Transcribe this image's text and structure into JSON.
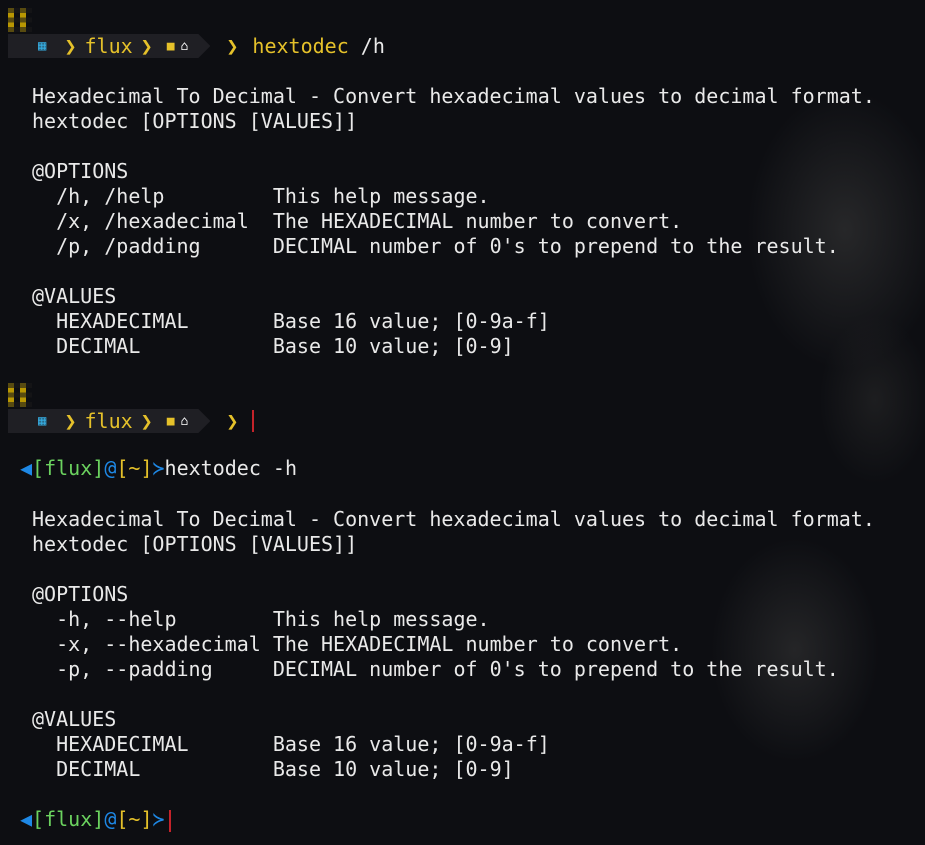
{
  "prompt1": {
    "user": "flux",
    "command_name": "hextodec",
    "command_arg": "/h"
  },
  "output1": {
    "title": "Hexadecimal To Decimal - Convert hexadecimal values to decimal format.",
    "usage": "hextodec [OPTIONS [VALUES]]",
    "options_header": "@OPTIONS",
    "options": [
      {
        "flag": "  /h, /help         ",
        "desc": "This help message."
      },
      {
        "flag": "  /x, /hexadecimal  ",
        "desc": "The HEXADECIMAL number to convert."
      },
      {
        "flag": "  /p, /padding      ",
        "desc": "DECIMAL number of 0's to prepend to the result."
      }
    ],
    "values_header": "@VALUES",
    "values": [
      {
        "name": "  HEXADECIMAL       ",
        "desc": "Base 16 value; [0-9a-f]"
      },
      {
        "name": "  DECIMAL           ",
        "desc": "Base 10 value; [0-9]"
      }
    ]
  },
  "prompt2": {
    "user": "flux"
  },
  "prompt3": {
    "user": "flux",
    "dir": "~",
    "command": "hextodec -h"
  },
  "output2": {
    "title": "Hexadecimal To Decimal - Convert hexadecimal values to decimal format.",
    "usage": "hextodec [OPTIONS [VALUES]]",
    "options_header": "@OPTIONS",
    "options": [
      {
        "flag": "  -h, --help        ",
        "desc": "This help message."
      },
      {
        "flag": "  -x, --hexadecimal ",
        "desc": "The HEXADECIMAL number to convert."
      },
      {
        "flag": "  -p, --padding     ",
        "desc": "DECIMAL number of 0's to prepend to the result."
      }
    ],
    "values_header": "@VALUES",
    "values": [
      {
        "name": "  HEXADECIMAL       ",
        "desc": "Base 16 value; [0-9a-f]"
      },
      {
        "name": "  DECIMAL           ",
        "desc": "Base 10 value; [0-9]"
      }
    ]
  },
  "prompt4": {
    "user": "flux",
    "dir": "~"
  },
  "colors": {
    "accent_yellow": "#e5c12a",
    "accent_blue": "#1e88e5",
    "accent_green": "#6bd25f",
    "cursor_red": "#c4232a",
    "windows_icon": "#36b0e6"
  },
  "icons": [
    "tag-icon",
    "windows-icon",
    "folder-icon",
    "home-icon",
    "chevron-right-icon"
  ]
}
